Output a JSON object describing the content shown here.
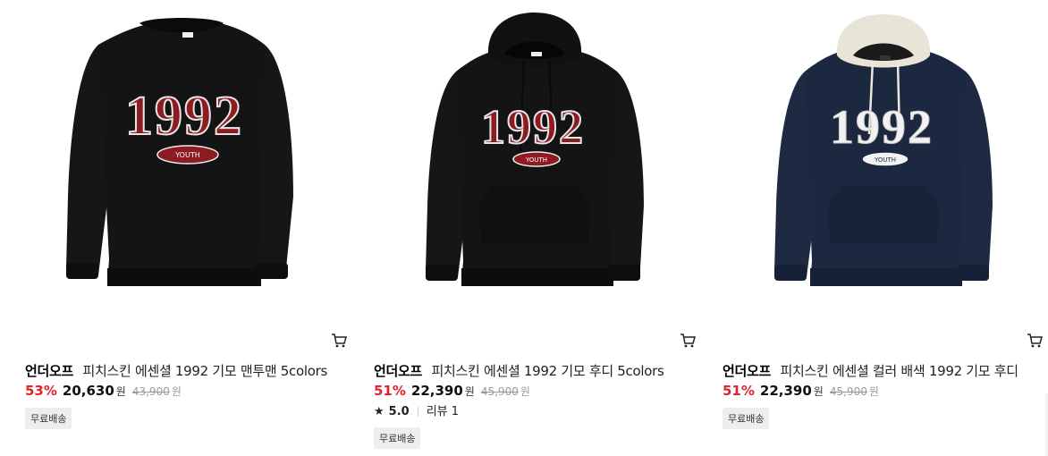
{
  "products": [
    {
      "brand": "언더오프",
      "name": "피치스킨 에센셜 1992 기모 맨투맨 5colors",
      "discount": "53%",
      "price": "20,630",
      "currency": "원",
      "original_price": "43,900",
      "badge": "무료배송",
      "print_text": "1992",
      "patch_text": "YOUTH",
      "garment_color": "#141414",
      "print_color": "#8c1c22",
      "icons": [
        "cart-icon"
      ]
    },
    {
      "brand": "언더오프",
      "name": "피치스킨 에센셜 1992 기모 후디 5colors",
      "discount": "51%",
      "price": "22,390",
      "currency": "원",
      "original_price": "45,900",
      "rating_star": "★",
      "rating": "5.0",
      "review": "리뷰 1",
      "badge": "무료배송",
      "print_text": "1992",
      "patch_text": "YOUTH",
      "garment_color": "#141414",
      "print_color": "#8c1c22",
      "icons": [
        "cart-icon",
        "star-icon"
      ]
    },
    {
      "brand": "언더오프",
      "name": "피치스킨 에센셜 컬러 배색 1992 기모 후디",
      "discount": "51%",
      "price": "22,390",
      "currency": "원",
      "original_price": "45,900",
      "badge": "무료배송",
      "print_text": "1992",
      "patch_text": "YOUTH",
      "garment_color": "#1c2840",
      "hood_color": "#e9e4d8",
      "print_color": "#f2f2f2",
      "icons": [
        "cart-icon"
      ]
    }
  ],
  "colors": {
    "discount": "#e5212a",
    "strike": "#999999",
    "badge_bg": "#eeeeee"
  }
}
